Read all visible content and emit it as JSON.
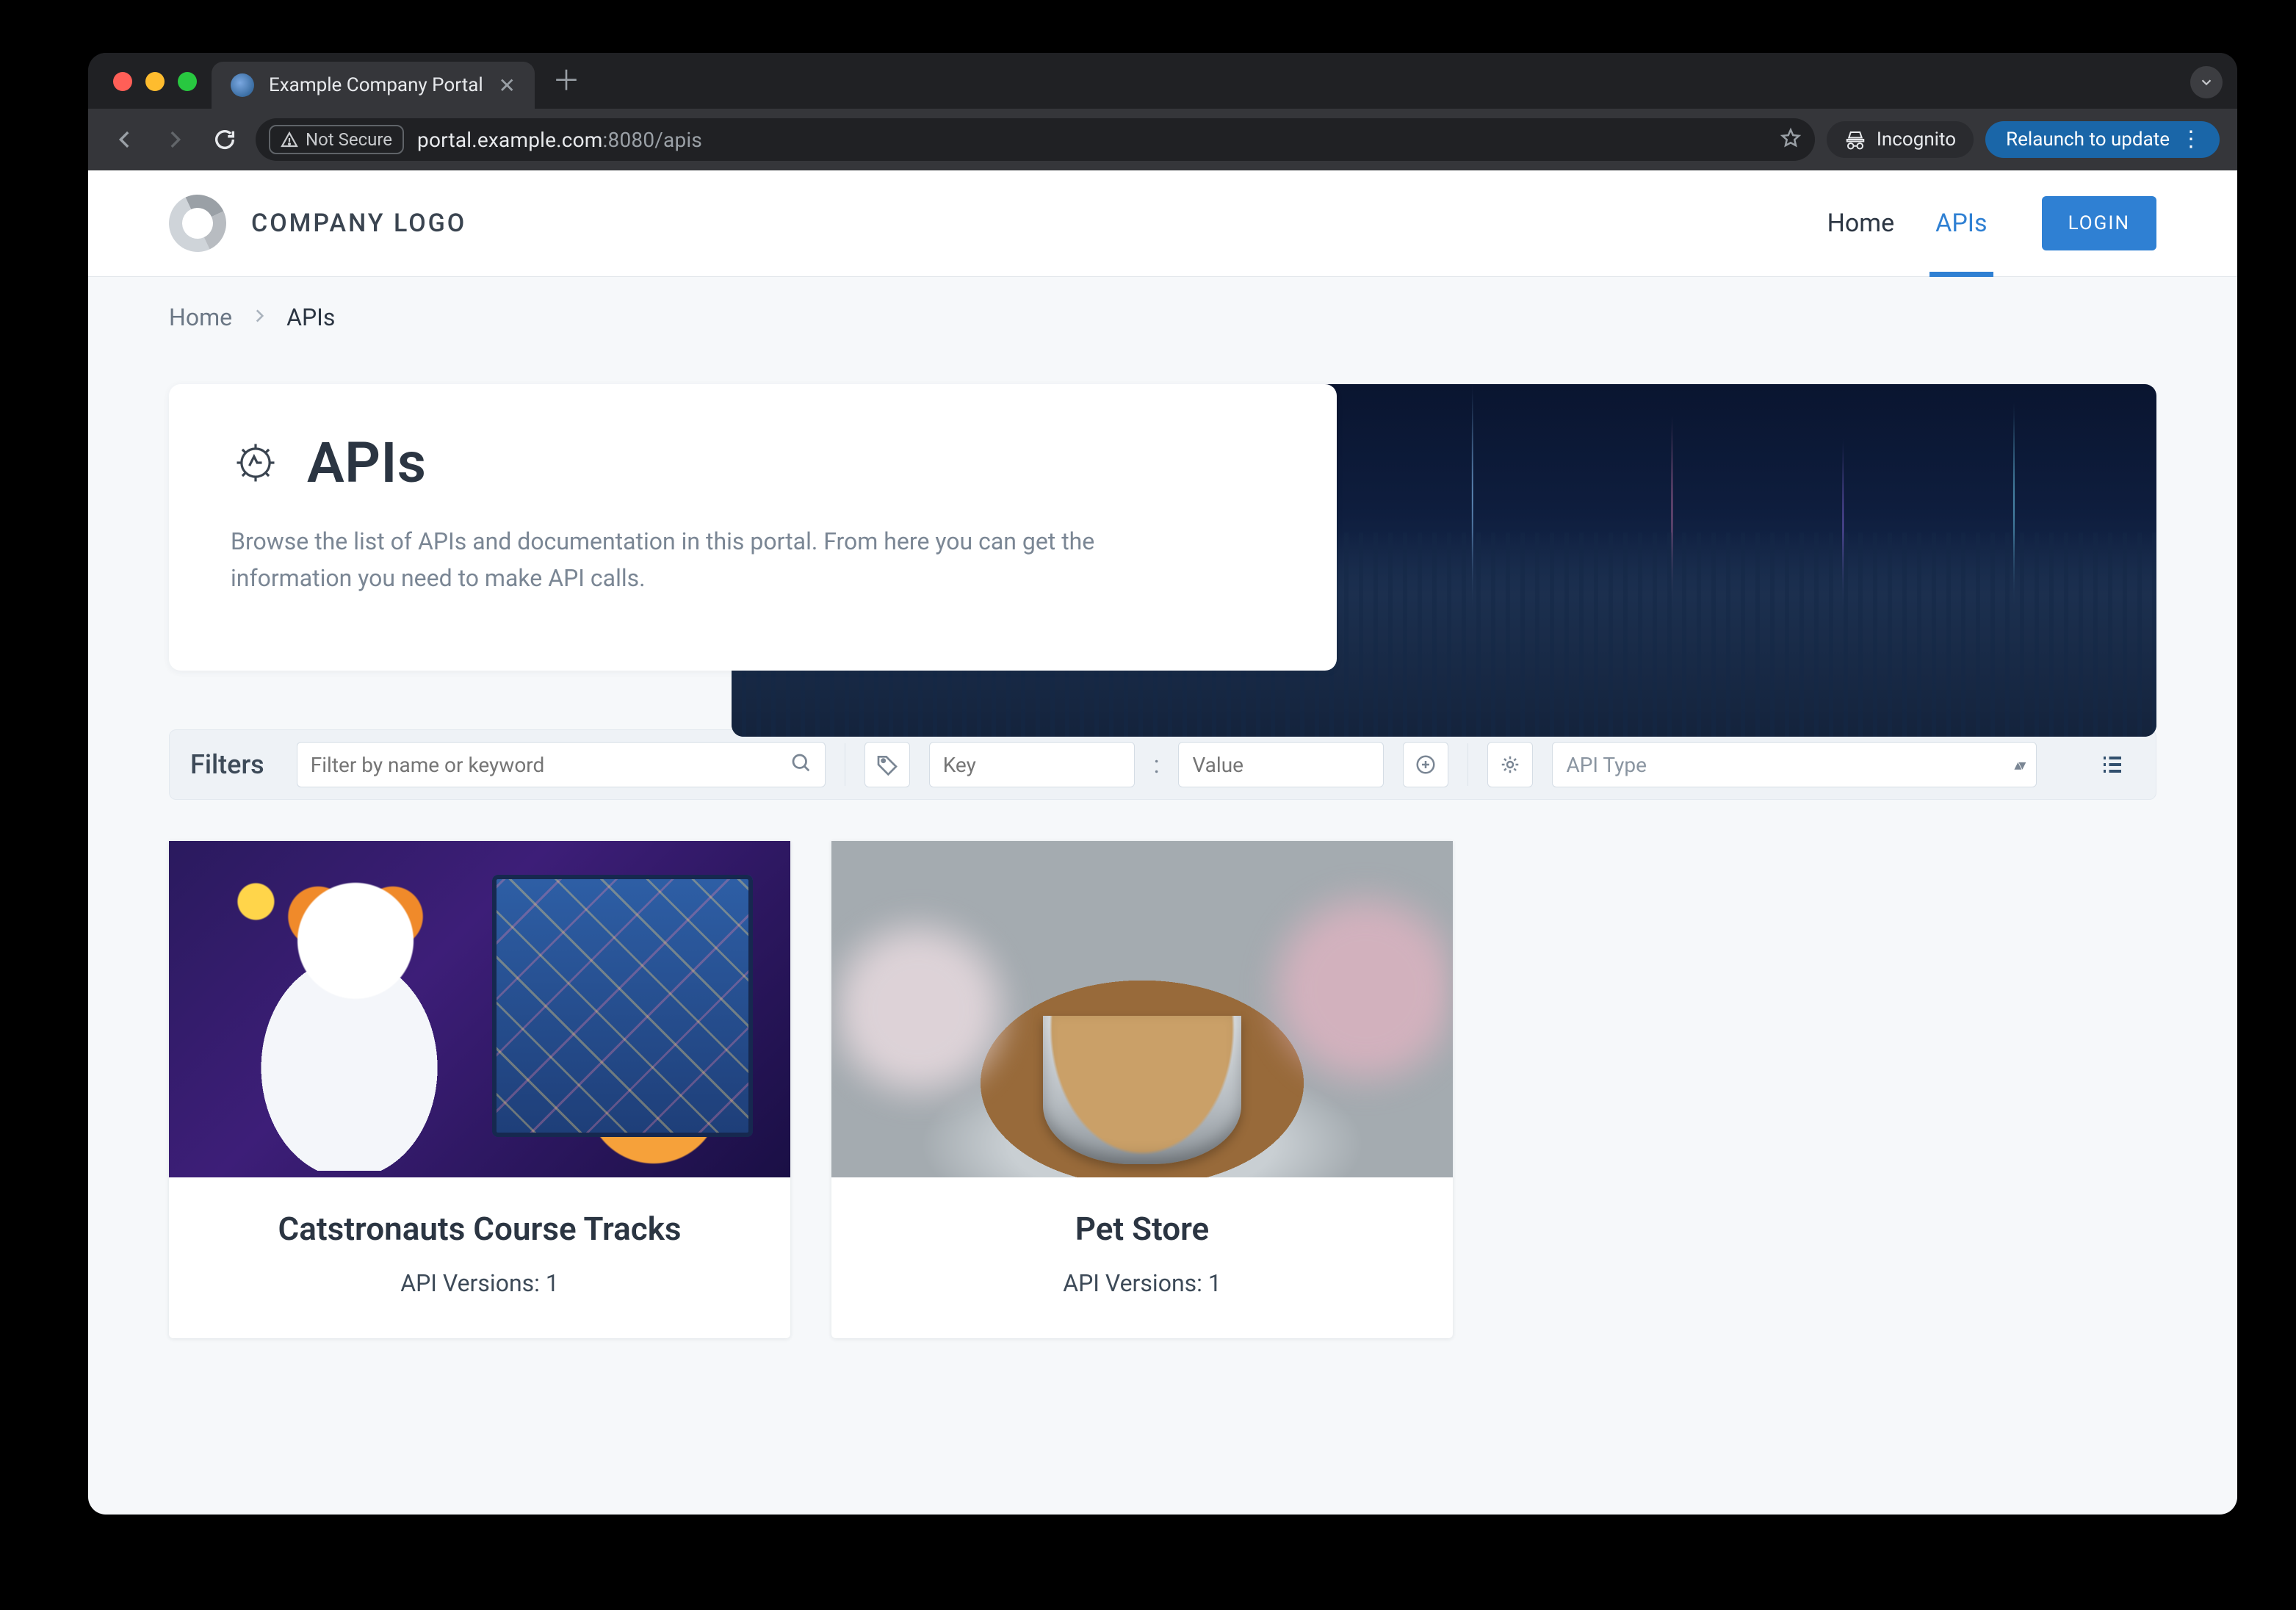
{
  "browser": {
    "tab_title": "Example Company Portal",
    "not_secure_label": "Not Secure",
    "url_host": "portal.example.com",
    "url_port": ":8080",
    "url_path": "/apis",
    "incognito_label": "Incognito",
    "relaunch_label": "Relaunch to update"
  },
  "header": {
    "logo_text": "COMPANY LOGO",
    "nav": {
      "home": "Home",
      "apis": "APIs"
    },
    "login_label": "LOGIN"
  },
  "breadcrumbs": {
    "home": "Home",
    "current": "APIs"
  },
  "hero": {
    "title": "APIs",
    "description": "Browse the list of APIs and documentation in this portal. From here you can get the information you need to make API calls."
  },
  "filters": {
    "label": "Filters",
    "search_placeholder": "Filter by name or keyword",
    "key_placeholder": "Key",
    "value_placeholder": "Value",
    "colon": ":",
    "type_select_label": "API Type"
  },
  "cards": [
    {
      "title": "Catstronauts Course Tracks",
      "versions_label": "API Versions: 1"
    },
    {
      "title": "Pet Store",
      "versions_label": "API Versions: 1"
    }
  ]
}
